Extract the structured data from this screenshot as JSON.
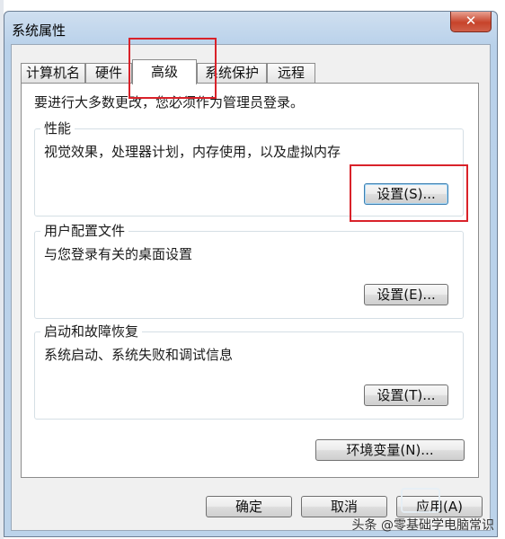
{
  "window": {
    "title": "系统属性",
    "close_glyph": "✕"
  },
  "tabs": [
    {
      "label": "计算机名",
      "active": false
    },
    {
      "label": "硬件",
      "active": false
    },
    {
      "label": "高级",
      "active": true
    },
    {
      "label": "系统保护",
      "active": false
    },
    {
      "label": "远程",
      "active": false
    }
  ],
  "notice": "要进行大多数更改，您必须作为管理员登录。",
  "performance": {
    "title": "性能",
    "description": "视觉效果，处理器计划，内存使用，以及虚拟内存",
    "button": "设置(S)..."
  },
  "user_profiles": {
    "title": "用户配置文件",
    "description": "与您登录有关的桌面设置",
    "button": "设置(E)..."
  },
  "startup_recovery": {
    "title": "启动和故障恢复",
    "description": "系统启动、系统失败和调试信息",
    "button": "设置(T)..."
  },
  "env_button": "环境变量(N)...",
  "footer": {
    "ok": "确定",
    "cancel": "取消",
    "apply": "应用(A)"
  },
  "watermark": "头条 @零基础学电脑常识",
  "colors": {
    "callout": "#d9222a",
    "focus_border": "#3c7fb1",
    "title_bar": "#b9d1ea"
  }
}
